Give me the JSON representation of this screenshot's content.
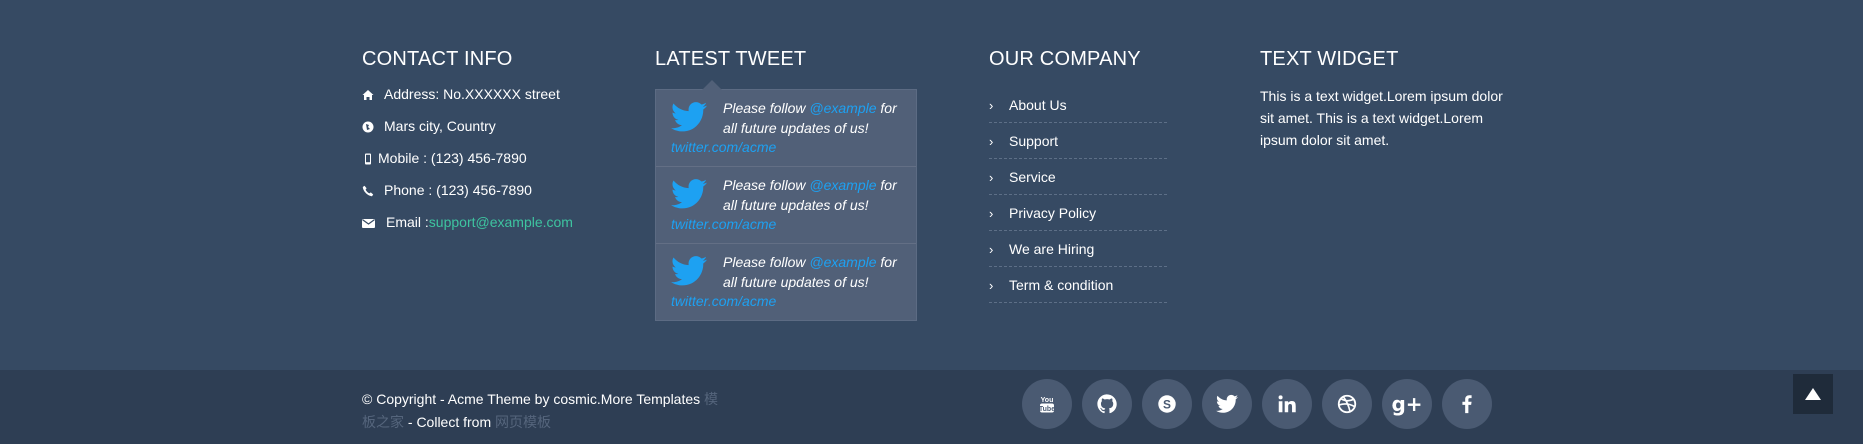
{
  "contact": {
    "title": "CONTACT INFO",
    "items": [
      {
        "icon": "home-icon",
        "text": "Address: No.XXXXXX street"
      },
      {
        "icon": "globe-icon",
        "text": "Mars city, Country"
      },
      {
        "icon": "mobile-icon",
        "text": "Mobile : (123) 456-7890"
      },
      {
        "icon": "phone-icon",
        "text": "Phone : (123) 456-7890"
      }
    ],
    "email_label": "Email : ",
    "email": "support@example.com"
  },
  "tweets": {
    "title": "LATEST TWEET",
    "items": [
      {
        "pre": "Please follow ",
        "mention": "@example",
        "post": " for all future updates of us!",
        "link": "twitter.com/acme"
      },
      {
        "pre": "Please follow ",
        "mention": "@example",
        "post": " for all future updates of us!",
        "link": "twitter.com/acme"
      },
      {
        "pre": "Please follow ",
        "mention": "@example",
        "post": " for all future updates of us!",
        "link": "twitter.com/acme"
      }
    ]
  },
  "company": {
    "title": "OUR COMPANY",
    "links": [
      "About Us",
      "Support",
      "Service",
      "Privacy Policy",
      "We are Hiring",
      "Term & condition"
    ]
  },
  "text_widget": {
    "title": "TEXT WIDGET",
    "body": "This is a text widget.Lorem ipsum dolor sit amet. This is a text widget.Lorem ipsum dolor sit amet."
  },
  "footer": {
    "copyright": "© Copyright - Acme Theme by cosmic.More Templates ",
    "faded1": "模板之家",
    "collect": " - Collect from ",
    "faded2": "网页模板"
  },
  "social": [
    "youtube-icon",
    "github-icon",
    "skype-icon",
    "twitter-icon",
    "linkedin-icon",
    "dribbble-icon",
    "google-plus-icon",
    "facebook-icon"
  ],
  "colors": {
    "background": "#364a63",
    "bottom_bar": "#2e3e54",
    "accent": "#1da1f2",
    "email": "#3ec4a0"
  }
}
